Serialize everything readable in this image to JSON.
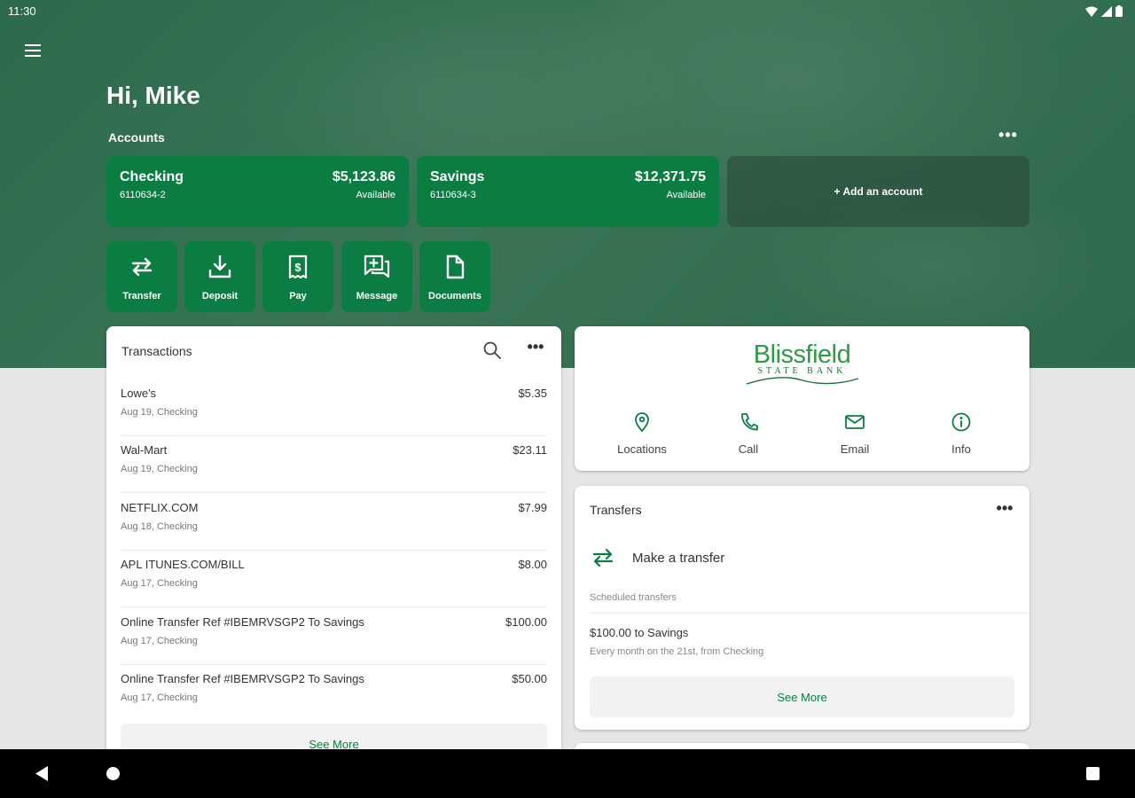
{
  "status_bar": {
    "time": "11:30"
  },
  "greeting": "Hi, Mike",
  "accounts": {
    "label": "Accounts",
    "more": "•••",
    "items": [
      {
        "name": "Checking",
        "number": "6110634-2",
        "balance": "$5,123.86",
        "balance_label": "Available"
      },
      {
        "name": "Savings",
        "number": "6110634-3",
        "balance": "$12,371.75",
        "balance_label": "Available"
      }
    ],
    "add_label": "+ Add an account"
  },
  "quick_actions": [
    {
      "label": "Transfer",
      "icon": "transfer-icon"
    },
    {
      "label": "Deposit",
      "icon": "deposit-icon"
    },
    {
      "label": "Pay",
      "icon": "pay-icon"
    },
    {
      "label": "Message",
      "icon": "message-icon"
    },
    {
      "label": "Documents",
      "icon": "documents-icon"
    }
  ],
  "transactions": {
    "title": "Transactions",
    "more": "•••",
    "items": [
      {
        "name": "Lowe's",
        "sub": "Aug 19, Checking",
        "amount": "$5.35"
      },
      {
        "name": "Wal-Mart",
        "sub": "Aug 19, Checking",
        "amount": "$23.11"
      },
      {
        "name": "NETFLIX.COM",
        "sub": "Aug 18, Checking",
        "amount": "$7.99"
      },
      {
        "name": "APL ITUNES.COM/BILL",
        "sub": "Aug 17, Checking",
        "amount": "$8.00"
      },
      {
        "name": "Online Transfer Ref #IBEMRVSGP2 To Savings",
        "sub": "Aug 17, Checking",
        "amount": "$100.00"
      },
      {
        "name": "Online Transfer Ref #IBEMRVSGP2 To Savings",
        "sub": "Aug 17, Checking",
        "amount": "$50.00"
      }
    ],
    "see_more": "See More"
  },
  "bank": {
    "logo_main": "Blissfield",
    "logo_sub": "STATE BANK",
    "actions": [
      {
        "label": "Locations",
        "icon": "location-pin-icon"
      },
      {
        "label": "Call",
        "icon": "phone-icon"
      },
      {
        "label": "Email",
        "icon": "email-icon"
      },
      {
        "label": "Info",
        "icon": "info-icon"
      }
    ]
  },
  "transfers": {
    "title": "Transfers",
    "more": "•••",
    "make_label": "Make a transfer",
    "scheduled_label": "Scheduled transfers",
    "scheduled": [
      {
        "title": "$100.00 to Savings",
        "sub": "Every month on the 21st, from Checking"
      }
    ],
    "see_more": "See More"
  },
  "colors": {
    "brand_green": "#0c7d42",
    "hero_green": "#356e50",
    "logo_green": "#2e9a46"
  }
}
